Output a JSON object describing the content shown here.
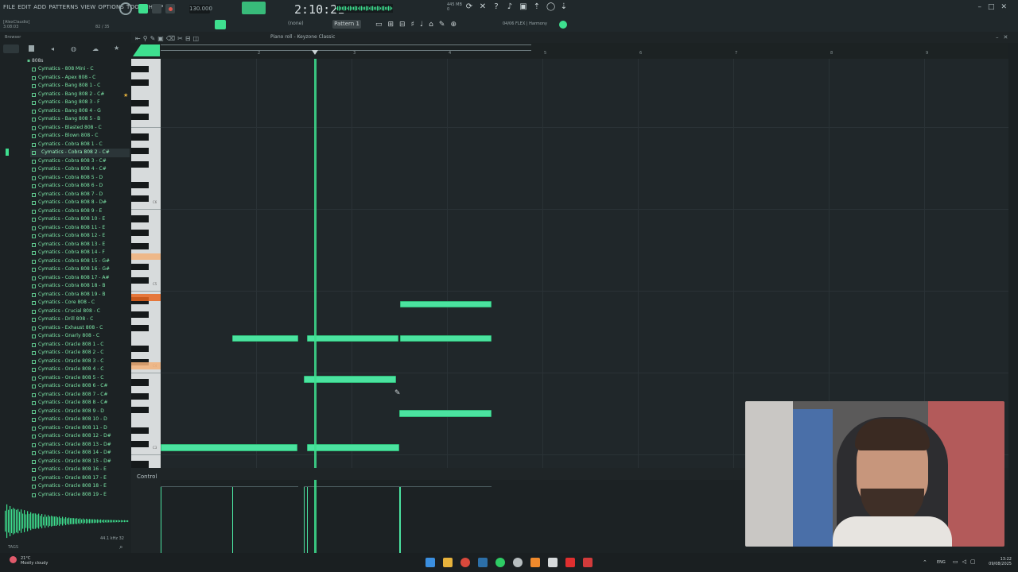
{
  "menu": [
    "FILE",
    "EDIT",
    "ADD",
    "PATTERNS",
    "VIEW",
    "OPTIONS",
    "TOOLS",
    "HELP"
  ],
  "transport": {
    "tempo": "130.000",
    "time": "2:10:21",
    "memory": "445 MB",
    "memory_sub": "0"
  },
  "hint": {
    "line1": "[AlexClaudio]",
    "line2": "3:08:03"
  },
  "cpu": "82 / 35",
  "pattern": "Pattern 1",
  "snap": "(none)",
  "flex": "04/06  FLEX | Harmony",
  "browser": {
    "title": "Browser",
    "folder": "808s",
    "files": [
      "Cymatics - 808 Mini - C",
      "Cymatics - Apex 808 - C",
      "Cymatics - Bang 808 1 - C",
      "Cymatics - Bang 808 2 - C#",
      "Cymatics - Bang 808 3 - F",
      "Cymatics - Bang 808 4 - G",
      "Cymatics - Bang 808 5 - B",
      "Cymatics - Blasted 808 - C",
      "Cymatics - Blown 808 - C",
      "Cymatics - Cobra 808 1 - C",
      "Cymatics - Cobra 808 2 - C#",
      "Cymatics - Cobra 808 3 - C#",
      "Cymatics - Cobra 808 4 - C#",
      "Cymatics - Cobra 808 5 - D",
      "Cymatics - Cobra 808 6 - D",
      "Cymatics - Cobra 808 7 - D",
      "Cymatics - Cobra 808 8 - D#",
      "Cymatics - Cobra 808 9 - E",
      "Cymatics - Cobra 808 10 - E",
      "Cymatics - Cobra 808 11 - E",
      "Cymatics - Cobra 808 12 - E",
      "Cymatics - Cobra 808 13 - E",
      "Cymatics - Cobra 808 14 - F",
      "Cymatics - Cobra 808 15 - G#",
      "Cymatics - Cobra 808 16 - G#",
      "Cymatics - Cobra 808 17 - A#",
      "Cymatics - Cobra 808 18 - B",
      "Cymatics - Cobra 808 19 - B",
      "Cymatics - Core 808 - C",
      "Cymatics - Crucial 808 - C",
      "Cymatics - Drill 808 - C",
      "Cymatics - Exhaust 808 - C",
      "Cymatics - Gnarly 808 - C",
      "Cymatics - Oracle 808 1 - C",
      "Cymatics - Oracle 808 2 - C",
      "Cymatics - Oracle 808 3 - C",
      "Cymatics - Oracle 808 4 - C",
      "Cymatics - Oracle 808 5 - C",
      "Cymatics - Oracle 808 6 - C#",
      "Cymatics - Oracle 808 7 - C#",
      "Cymatics - Oracle 808 8 - C#",
      "Cymatics - Oracle 808 9 - D",
      "Cymatics - Oracle 808 10 - D",
      "Cymatics - Oracle 808 11 - D",
      "Cymatics - Oracle 808 12 - D#",
      "Cymatics - Oracle 808 13 - D#",
      "Cymatics - Oracle 808 14 - D#",
      "Cymatics - Oracle 808 15 - D#",
      "Cymatics - Oracle 808 16 - E",
      "Cymatics - Oracle 808 17 - E",
      "Cymatics - Oracle 808 18 - E",
      "Cymatics - Oracle 808 19 - E"
    ],
    "selected_index": 10,
    "samplerate": "44.1 kHz 32",
    "tags": "TAGS"
  },
  "piano_roll": {
    "title": "Piano roll - Keyzone Classic",
    "control_label": "Control",
    "ruler_numbers": [
      "2",
      "3",
      "4",
      "5",
      "6",
      "7",
      "8",
      "9"
    ],
    "octave_labels": [
      "C6",
      "C5",
      "C4",
      "C3"
    ],
    "note_color": "#4be3a0",
    "playhead_color": "#3ee08f",
    "notes": [
      {
        "bar": 3.51,
        "len": 0.96,
        "pitch": "A4"
      },
      {
        "bar": 1.75,
        "len": 0.69,
        "pitch": "E4"
      },
      {
        "bar": 2.53,
        "len": 0.96,
        "pitch": "E4"
      },
      {
        "bar": 3.51,
        "len": 0.96,
        "pitch": "E4"
      },
      {
        "bar": 2.5,
        "len": 0.97,
        "pitch": "A#3"
      },
      {
        "bar": 3.5,
        "len": 0.97,
        "pitch": "F3"
      },
      {
        "bar": 1.0,
        "len": 1.43,
        "pitch": "C3"
      },
      {
        "bar": 2.53,
        "len": 0.97,
        "pitch": "C3"
      }
    ]
  },
  "taskbar": {
    "weather_temp": "21°C",
    "weather_desc": "Mostly cloudy",
    "lang": "ENG",
    "time": "13:22",
    "date": "09/08/2025"
  }
}
